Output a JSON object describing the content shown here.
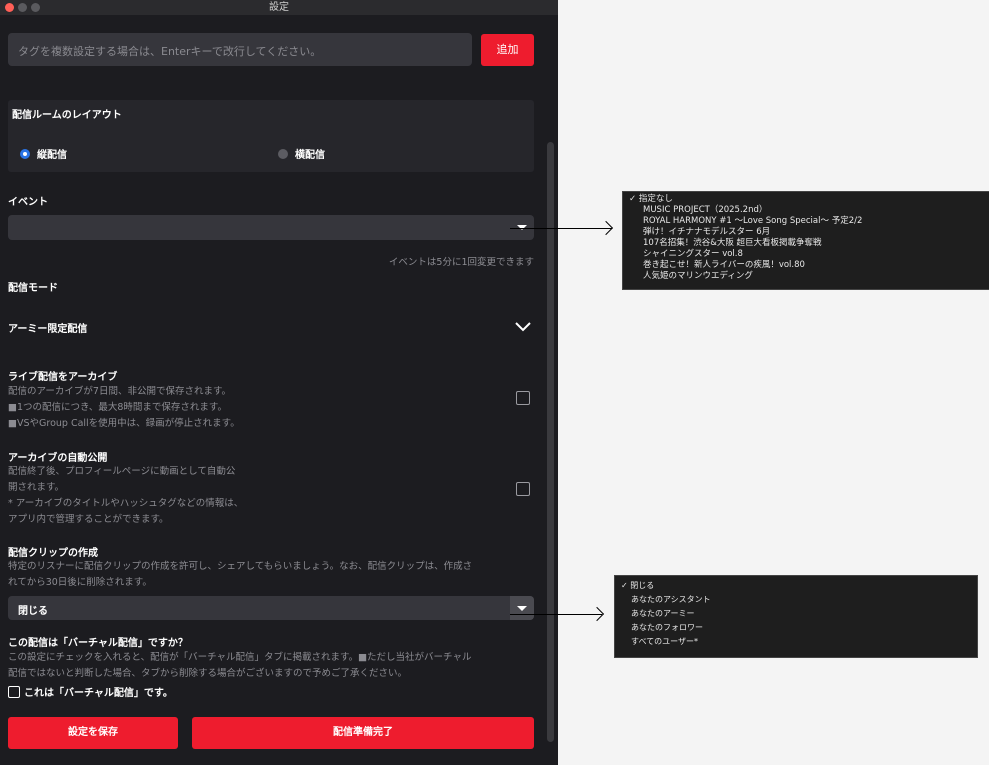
{
  "window": {
    "title": "設定"
  },
  "tags": {
    "placeholder": "タグを複数設定する場合は、Enterキーで改行してください。",
    "add_label": "追加"
  },
  "layout_section": {
    "title": "配信ルームのレイアウト",
    "options": [
      {
        "label": "縦配信",
        "selected": true
      },
      {
        "label": "横配信",
        "selected": false
      }
    ]
  },
  "event": {
    "label": "イベント",
    "value": "",
    "note": "イベントは5分に1回変更できます",
    "options": [
      "指定なし",
      "MUSIC PROJECT（2025.2nd）",
      "ROYAL HARMONY #1 〜Love Song Special〜 予定2/2",
      "弾け！イチナナモデルスター 6月",
      "107名招集！渋谷&大阪 超巨大看板掲載争奪戦",
      "シャイニングスター vol.8",
      "巻き起こせ！新人ライバーの疾風！vol.80",
      "人気姫のマリンウエディング"
    ],
    "selected_option": "指定なし"
  },
  "mode": {
    "label": "配信モード",
    "army_label": "アーミー限定配信"
  },
  "archive": {
    "title": "ライブ配信をアーカイブ",
    "desc": [
      "配信のアーカイブが7日間、非公開で保存されます。",
      "■1つの配信につき、最大8時間まで保存されます。",
      "■VSやGroup Callを使用中は、録画が停止されます。"
    ],
    "checked": false
  },
  "auto_publish": {
    "title": "アーカイブの自動公開",
    "desc": [
      "配信終了後、プロフィールページに動画として自動公",
      "開されます。",
      "* アーカイブのタイトルやハッシュタグなどの情報は、",
      "アプリ内で管理することができます。"
    ],
    "checked": false
  },
  "clip": {
    "title": "配信クリップの作成",
    "desc": [
      "特定のリスナーに配信クリップの作成を許可し、シェアしてもらいましょう。なお、配信クリップは、作成さ",
      "れてから30日後に削除されます。"
    ],
    "value": "閉じる",
    "options": [
      "閉じる",
      "あなたのアシスタント",
      "あなたのアーミー",
      "あなたのフォロワー",
      "すべてのユーザー*"
    ],
    "selected_option": "閉じる"
  },
  "virtual": {
    "title": "この配信は「バーチャル配信」ですか？",
    "desc": [
      "この設定にチェックを入れると、配信が「バーチャル配信」タブに掲載されます。■ただし当社がバーチャル",
      "配信ではないと判断した場合、タブから削除する場合がございますので予めご了承ください。"
    ],
    "check_label": "これは「バーチャル配信」です。",
    "checked": false
  },
  "footer": {
    "save_label": "設定を保存",
    "ready_label": "配信準備完了"
  },
  "colors": {
    "accent": "#ee1c2e",
    "radio": "#2a74e6",
    "bg": "#1c1c20"
  }
}
